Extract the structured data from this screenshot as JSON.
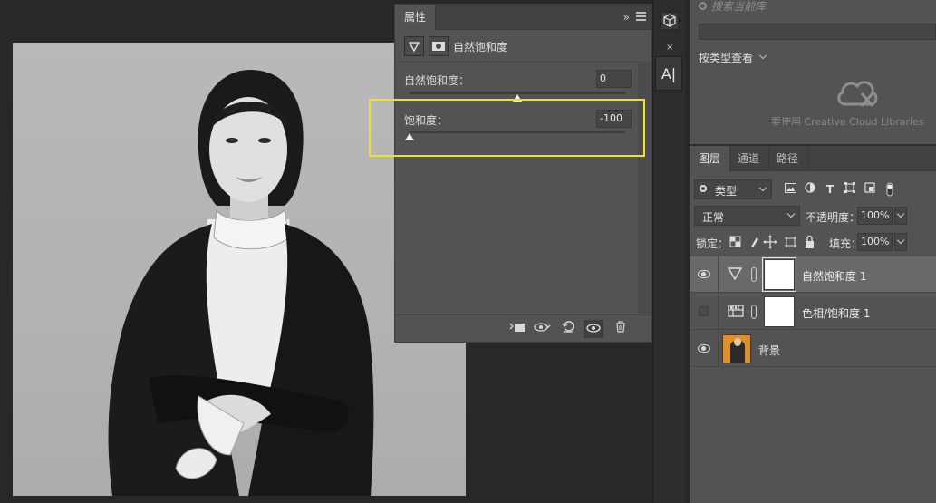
{
  "properties_panel": {
    "tab_label": "属性",
    "collapse_glyph": "»",
    "header_title": "自然饱和度",
    "vibrance": {
      "label": "自然饱和度：",
      "value": "0",
      "slider_fraction": 0.5
    },
    "saturation": {
      "label": "饱和度：",
      "value": "-100",
      "slider_fraction": 0.0
    },
    "footer_buttons": [
      "clip-to-layer-icon",
      "view-previous-icon",
      "reset-icon",
      "toggle-visibility-icon",
      "delete-icon"
    ]
  },
  "dock": {
    "close_glyph": "×",
    "char_button": "A|"
  },
  "libraries": {
    "search_placeholder": "搜索当前库",
    "view_by_type": "按类型查看",
    "cloud_message": "要使用 Creative Cloud Libraries"
  },
  "layers_panel": {
    "tabs": [
      "图层",
      "通道",
      "路径"
    ],
    "active_tab": 0,
    "filter_kind": "类型",
    "blend_mode": "正常",
    "opacity_label": "不透明度：",
    "opacity_value": "100%",
    "lock_label": "锁定：",
    "fill_label": "填充：",
    "fill_value": "100%",
    "layers": [
      {
        "name": "自然饱和度 1",
        "visible": true,
        "selected": true,
        "type": "vibrance-adjustment"
      },
      {
        "name": "色相/饱和度 1",
        "visible": false,
        "selected": false,
        "type": "hue-saturation-adjustment"
      },
      {
        "name": "背景",
        "visible": true,
        "selected": false,
        "type": "background"
      }
    ]
  },
  "colors": {
    "highlight": "#f2e41a",
    "panel_bg": "#535353",
    "canvas_bg": "#282828"
  }
}
